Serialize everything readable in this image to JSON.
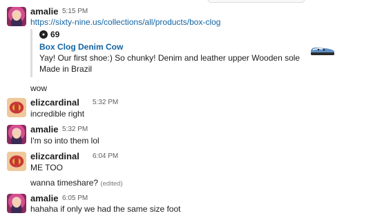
{
  "messages": [
    {
      "author": "amalie",
      "time": "5:15 PM",
      "link": "https://sixty-nine.us/collections/all/products/box-clog",
      "unfurl": {
        "site": "69",
        "title": "Box Clog Denim Cow",
        "description": "Yay! Our first shoe:) So chunky! Denim and leather upper Wooden sole Made in Brazil"
      },
      "followups": [
        "wow"
      ]
    },
    {
      "author": "elizcardinal",
      "time": "5:32 PM",
      "text": "incredible right"
    },
    {
      "author": "amalie",
      "time": "5:32 PM",
      "text": "I'm so into them lol"
    },
    {
      "author": "elizcardinal",
      "time": "6:04 PM",
      "text": "ME TOO",
      "followup": {
        "text": "wanna timeshare?",
        "edited": "(edited)"
      }
    },
    {
      "author": "amalie",
      "time": "6:05 PM",
      "text": "hahaha if only we had the same size foot"
    }
  ],
  "icons": {
    "unfurl_site": "sixty-nine-logo-icon",
    "thumbnail": "clog-shoe-thumbnail"
  },
  "colors": {
    "link": "#1264a3",
    "text": "#1d1c1d",
    "timestamp": "#616061",
    "unfurl_border": "#dddddd"
  }
}
